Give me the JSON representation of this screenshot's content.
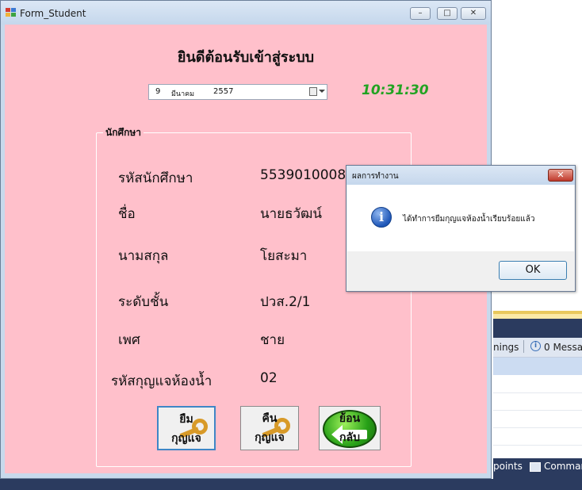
{
  "window": {
    "title": "Form_Student",
    "minimize_glyph": "–",
    "maximize_glyph": "□",
    "close_glyph": "✕"
  },
  "form": {
    "welcome": "ยินดีต้อนรับเข้าสู่ระบบ",
    "date": {
      "day": "9",
      "month": "มีนาคม",
      "year": "2557"
    },
    "clock": "10:31:30",
    "group_title": "นักศึกษา",
    "fields": [
      {
        "label": "รหัสนักศึกษา",
        "value": "5539010008"
      },
      {
        "label": "ชื่อ",
        "value": "นายธวัฒน์"
      },
      {
        "label": "นามสกุล",
        "value": "โยสะมา"
      },
      {
        "label": "ระดับชั้น",
        "value": "ปวส.2/1"
      },
      {
        "label": "เพศ",
        "value": "ชาย"
      },
      {
        "label": "รหัสกุญแจห้องน้ำ",
        "value": "02"
      }
    ],
    "buttons": {
      "borrow_line1": "ยืม",
      "borrow_line2": "กุญแจ",
      "return_line1": "คืน",
      "return_line2": "กุญแจ",
      "back_line1": "ย้อน",
      "back_line2": "กลับ"
    }
  },
  "dialog": {
    "title": "ผลการทำงาน",
    "message": "ได้ทำการยืมกุญแจห้องน้ำเรียบร้อยแล้ว",
    "ok_label": "OK",
    "close_glyph": "✕",
    "icon_glyph": "i"
  },
  "ide": {
    "warnings_tab": "nings",
    "messages_tab": "0 Messag",
    "breakpoints_tab": "points",
    "command_tab": "Comman"
  }
}
